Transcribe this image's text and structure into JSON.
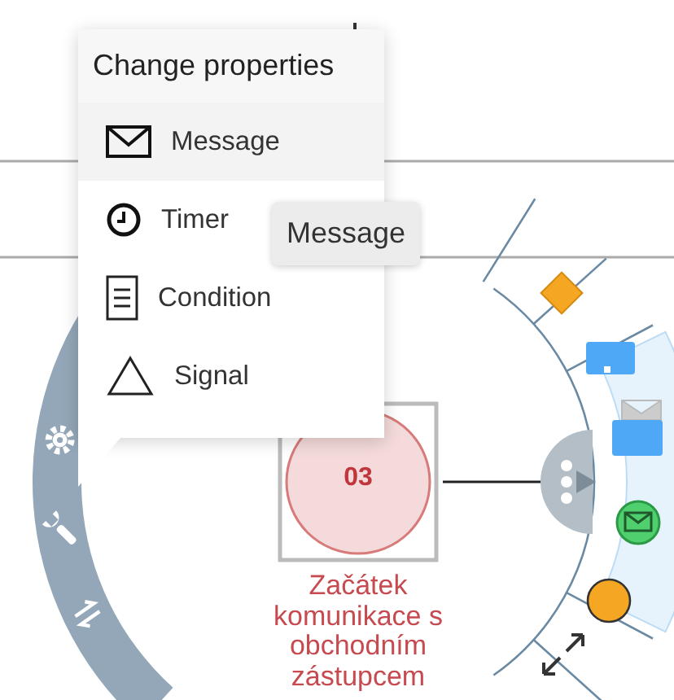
{
  "menu": {
    "title": "Change properties",
    "items": [
      {
        "label": "Message",
        "kind": "message",
        "selected": true
      },
      {
        "label": "Timer",
        "kind": "timer",
        "selected": false
      },
      {
        "label": "Condition",
        "kind": "condition",
        "selected": false
      },
      {
        "label": "Signal",
        "kind": "signal",
        "selected": false
      }
    ]
  },
  "tooltip": "Message",
  "node": {
    "number": "03",
    "label": "Začátek komunikace s obchodním zástupcem"
  }
}
